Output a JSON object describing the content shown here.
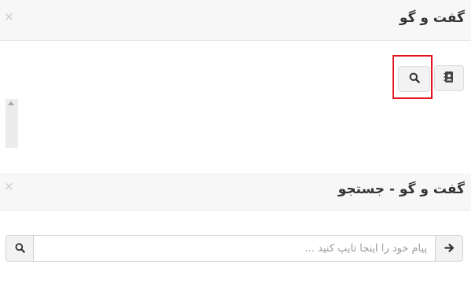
{
  "chat_panel": {
    "title": "گفت و گو",
    "close_glyph": "×",
    "toolbar": {
      "contacts_icon": "address-book-icon",
      "search_icon": "search-icon"
    }
  },
  "search_panel": {
    "title": "گفت و گو - جستجو",
    "close_glyph": "×"
  },
  "message_bar": {
    "placeholder": "پیام خود را اینجا تایپ کنید ...",
    "value": "",
    "search_icon": "search-icon",
    "send_icon": "arrow-right-icon"
  },
  "colors": {
    "highlight": "#e0141e",
    "header_bg": "#f7f7f7"
  }
}
